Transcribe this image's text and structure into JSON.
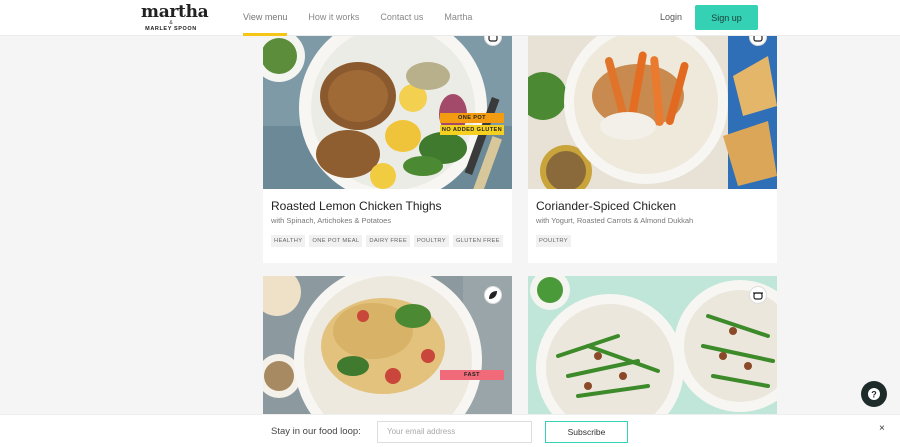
{
  "header": {
    "logo": {
      "main": "martha",
      "amp": "&",
      "sub": "MARLEY SPOON"
    },
    "nav": [
      {
        "label": "View menu",
        "active": true
      },
      {
        "label": "How it works"
      },
      {
        "label": "Contact us"
      },
      {
        "label": "Martha"
      }
    ],
    "login": "Login",
    "signup": "Sign up"
  },
  "cards": [
    {
      "title": "Roasted Lemon Chicken Thighs",
      "subtitle": "with Spinach, Artichokes & Potatoes",
      "labels": [
        "ONE POT",
        "NO ADDED GLUTEN"
      ],
      "tags": [
        "HEALTHY",
        "ONE POT MEAL",
        "DAIRY FREE",
        "POULTRY",
        "GLUTEN FREE"
      ],
      "icon": "pot-icon"
    },
    {
      "title": "Coriander-Spiced Chicken",
      "subtitle": "with Yogurt, Roasted Carrots & Almond Dukkah",
      "tags": [
        "POULTRY"
      ],
      "icon": "pot-icon"
    },
    {
      "labels": [
        "FAST"
      ],
      "icon": "leaf-icon"
    },
    {
      "icon": "pot-icon"
    }
  ],
  "subscribe": {
    "label": "Stay in our food loop:",
    "placeholder": "Your email address",
    "button": "Subscribe",
    "close": "×"
  },
  "colors": {
    "accent": "#34d1b4",
    "nav_underline": "#f5c518",
    "label_orange": "#f39c12",
    "label_yellow": "#f5d020",
    "label_pink": "#f06a7a"
  }
}
